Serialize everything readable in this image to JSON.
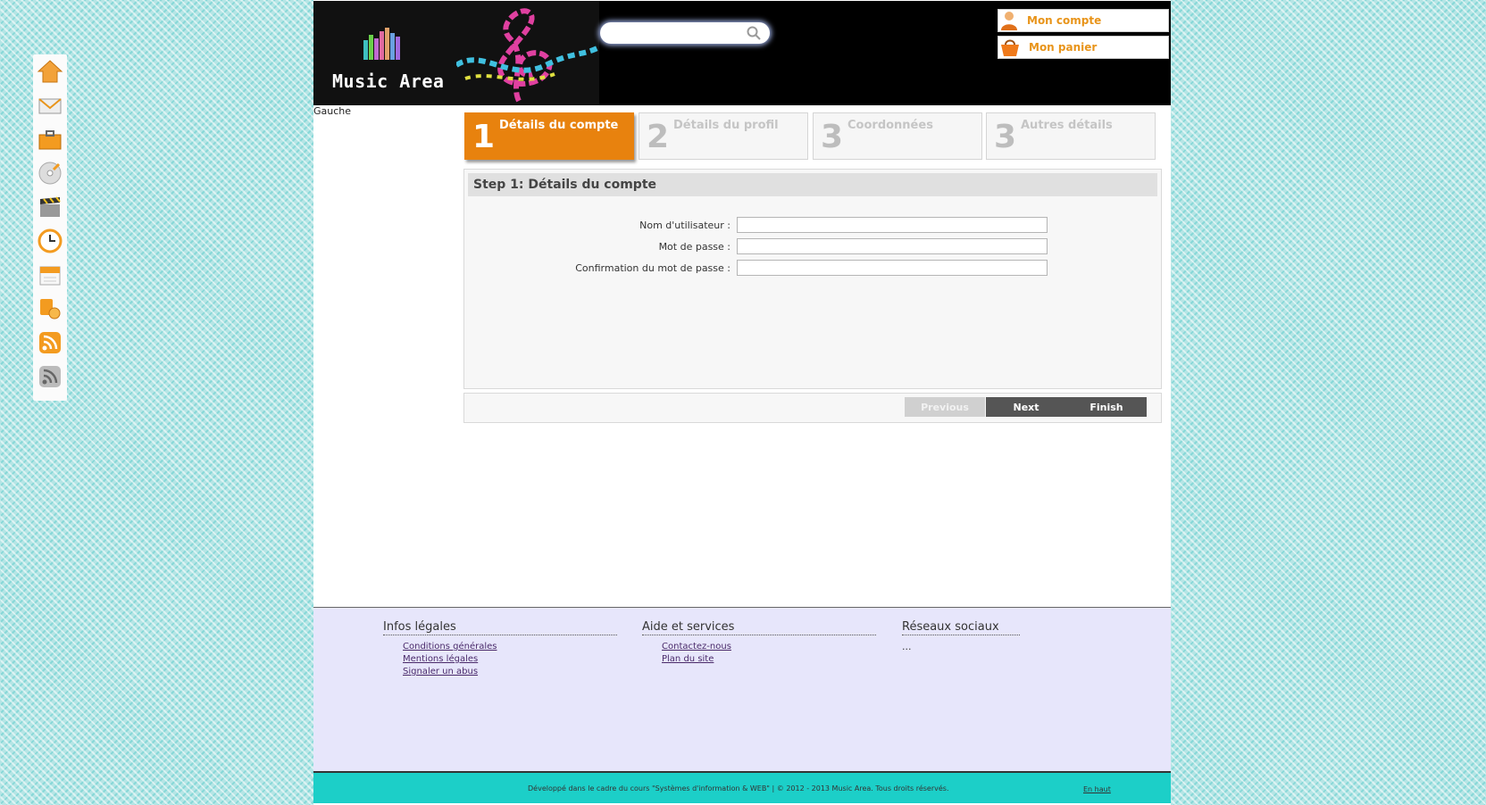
{
  "site": {
    "logo_text": "Music Area"
  },
  "search": {
    "value": "",
    "placeholder": ""
  },
  "account": {
    "my_account": "Mon compte",
    "my_cart": "Mon panier"
  },
  "sidebar": {
    "label": "Gauche",
    "icons": [
      "home-icon",
      "mail-icon",
      "briefcase-icon",
      "cd-icon",
      "clapperboard-icon",
      "clock-icon",
      "calendar-icon",
      "music-note-icon",
      "rss-orange-icon",
      "rss-grey-icon"
    ]
  },
  "wizard": {
    "steps": [
      {
        "number": "1",
        "label": "Détails du compte",
        "active": true
      },
      {
        "number": "2",
        "label": "Détails du profil",
        "active": false
      },
      {
        "number": "3",
        "label": "Coordonnées",
        "active": false
      },
      {
        "number": "3",
        "label": "Autres détails",
        "active": false
      }
    ],
    "panel_title": "Step 1: Détails du compte",
    "fields": [
      {
        "label": "Nom d'utilisateur :",
        "value": ""
      },
      {
        "label": "Mot de passe :",
        "value": ""
      },
      {
        "label": "Confirmation du mot de passe :",
        "value": ""
      }
    ],
    "buttons": {
      "previous": "Previous",
      "next": "Next",
      "finish": "Finish"
    }
  },
  "footer": {
    "columns": [
      {
        "title": "Infos légales",
        "links": [
          "Conditions générales",
          "Mentions légales",
          "Signaler un abus"
        ]
      },
      {
        "title": "Aide et services",
        "links": [
          "Contactez-nous",
          "Plan du site"
        ]
      },
      {
        "title": "Réseaux sociaux",
        "text": "..."
      }
    ],
    "copyright": "Développé dans le cadre du cours \"Systèmes d'information & WEB\" | © 2012 - 2013 Music Area. Tous droits réservés.",
    "back_to_top": "En haut"
  },
  "colors": {
    "accent": "#e8820e",
    "footer_bg": "#e7e6fb",
    "bottom_bar": "#1ccfc8"
  }
}
